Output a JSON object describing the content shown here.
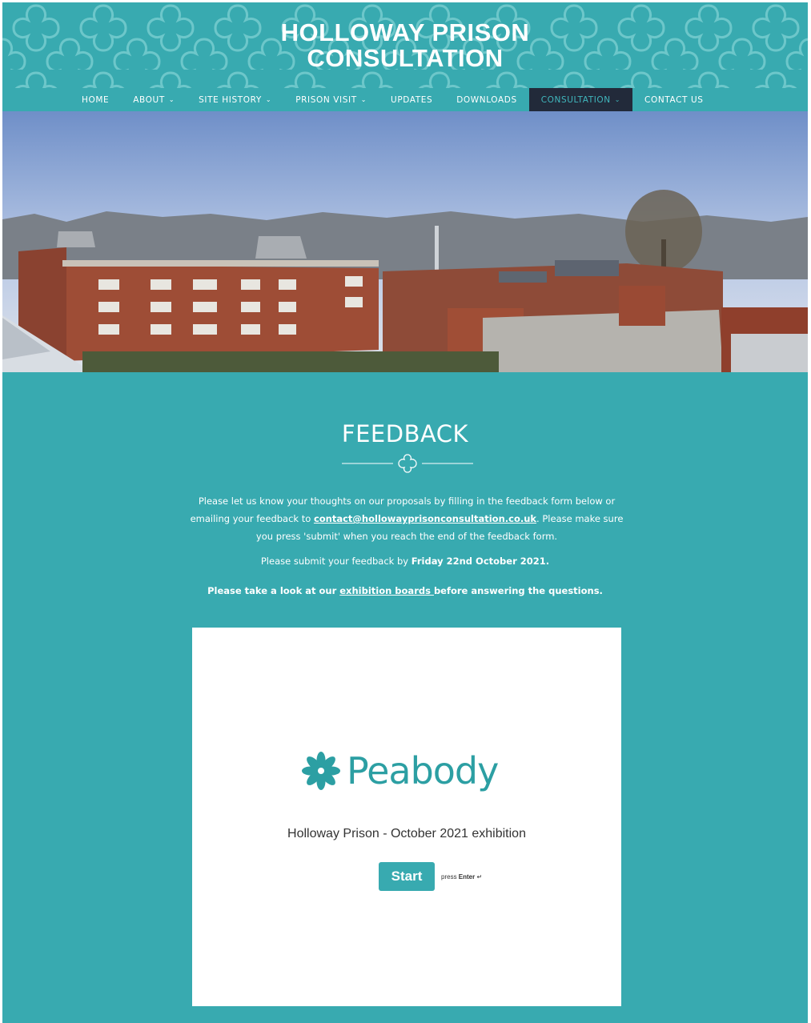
{
  "header": {
    "title_line1": "HOLLOWAY PRISON",
    "title_line2": "CONSULTATION"
  },
  "nav": {
    "items": [
      {
        "label": "HOME"
      },
      {
        "label": "ABOUT",
        "dropdown": "⌄"
      },
      {
        "label": "SITE HISTORY",
        "dropdown": "⌄"
      },
      {
        "label": "PRISON VISIT",
        "dropdown": "⌄"
      },
      {
        "label": "UPDATES"
      },
      {
        "label": "DOWNLOADS"
      },
      {
        "label": "CONSULTATION",
        "dropdown": "⌄",
        "active": true
      },
      {
        "label": "CONTACT US"
      }
    ]
  },
  "main": {
    "title": "FEEDBACK",
    "intro_before": "Please let us know your thoughts on our proposals by filling in the feedback form below or emailing your feedback to ",
    "intro_email": "contact@hollowayprisonconsultation.co.uk",
    "intro_after": ". Please make sure you press 'submit' when you reach the end of the feedback form.",
    "deadline_before": "Please submit your feedback by ",
    "deadline_date": "Friday 22nd October 2021.",
    "look_before": "Please take a look at our ",
    "look_link": "exhibition boards ",
    "look_after": "before answering the questions."
  },
  "form": {
    "logo_text": "Peabody",
    "subtitle": "Holloway Prison - October 2021 exhibition",
    "start_label": "Start",
    "press_label": "press ",
    "enter_label": "Enter",
    "enter_symbol": "↵"
  },
  "colors": {
    "teal": "#38aab0",
    "nav_active_bg": "#222a3a",
    "logo_teal": "#2c9fa3"
  }
}
